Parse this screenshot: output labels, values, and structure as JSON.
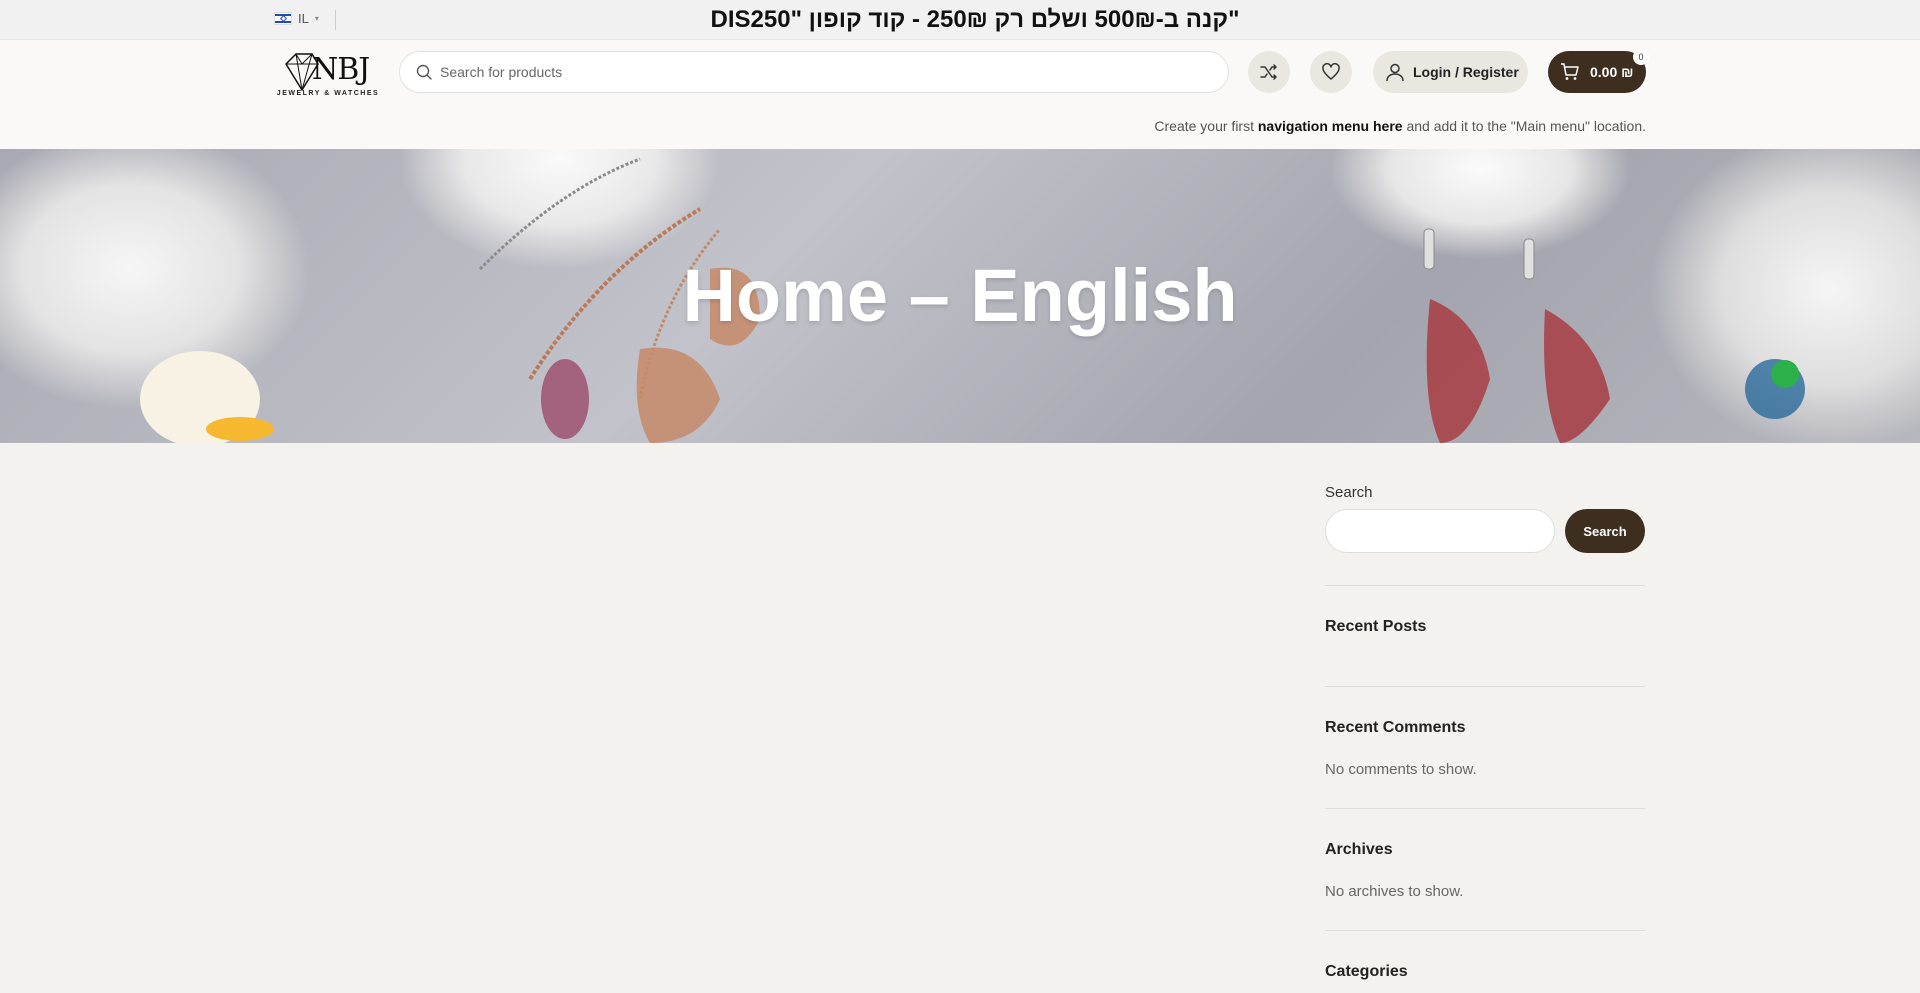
{
  "topbar": {
    "lang_code": "IL",
    "promo": "\"קנה ב-500₪ ושלם רק 250₪ - קוד קופון \"DIS250"
  },
  "header": {
    "logo_text": "NBJ",
    "logo_sub": "JEWELRY & WATCHES",
    "search_placeholder": "Search for products",
    "login_label": "Login / Register",
    "cart_amount": "0.00 ₪",
    "cart_count": "0",
    "nav_note_pre": "Create your first ",
    "nav_note_link": "navigation menu here",
    "nav_note_post": " and add it to the \"Main menu\" location."
  },
  "hero": {
    "title": "Home – English"
  },
  "sidebar": {
    "search_label": "Search",
    "search_button": "Search",
    "recent_posts_title": "Recent Posts",
    "recent_comments_title": "Recent Comments",
    "recent_comments_empty": "No comments to show.",
    "archives_title": "Archives",
    "archives_empty": "No archives to show.",
    "categories_title": "Categories"
  },
  "colors": {
    "accent": "#3d2e20",
    "page_bg": "#f3f2ee"
  },
  "icons": [
    "flag-israel-icon",
    "chevron-down-icon",
    "search-icon",
    "shuffle-icon",
    "heart-icon",
    "user-icon",
    "cart-icon"
  ]
}
